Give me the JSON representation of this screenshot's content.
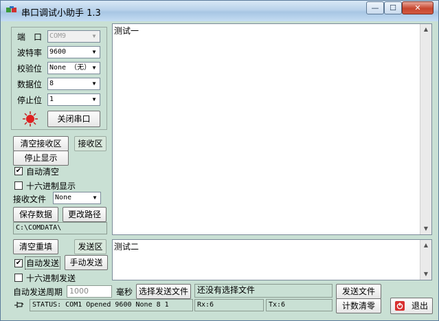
{
  "window": {
    "title": "串口调试小助手 1.3",
    "controls": {
      "minimize": "—",
      "maximize": "☐",
      "close": "✕"
    }
  },
  "port_settings": {
    "port": {
      "label": "端　口",
      "value": "COM9"
    },
    "baud": {
      "label": "波特率",
      "value": "9600"
    },
    "parity": {
      "label": "校验位",
      "value": "None （无）"
    },
    "databits": {
      "label": "数据位",
      "value": "8"
    },
    "stopbits": {
      "label": "停止位",
      "value": "1"
    },
    "close_port_button": "关闭串口",
    "port_indicator": {
      "icon": "red-led-icon",
      "color": "#e02020"
    }
  },
  "receive": {
    "clear_button": "清空接收区",
    "area_label": "接收区",
    "stop_display_button": "停止显示",
    "auto_clear": {
      "label": "自动清空",
      "checked": true
    },
    "hex_display": {
      "label": "十六进制显示",
      "checked": false
    },
    "file_label": "接收文件",
    "file_type": "None",
    "save_button": "保存数据",
    "change_path_button": "更改路径",
    "path": "C:\\COMDATA\\",
    "content": "测试一"
  },
  "send": {
    "clear_button": "清空重填",
    "area_label": "发送区",
    "auto_send": {
      "label": "自动发送",
      "checked": true
    },
    "manual_send_button": "手动发送",
    "hex_send": {
      "label": "十六进制发送",
      "checked": false
    },
    "period_label": "自动发送周期",
    "period_value": "1000",
    "period_unit": "毫秒",
    "choose_file_button": "选择发送文件",
    "file_status": "还没有选择文件",
    "send_file_button": "发送文件",
    "content": "测试二"
  },
  "status": {
    "text": "STATUS: COM1 Opened 9600 None  8 1",
    "rx": "Rx:6",
    "tx": "Tx:6",
    "count_clear_button": "计数清零",
    "exit_button": "退出",
    "pin_icon": "pin-icon",
    "exit_icon": "power-icon"
  }
}
